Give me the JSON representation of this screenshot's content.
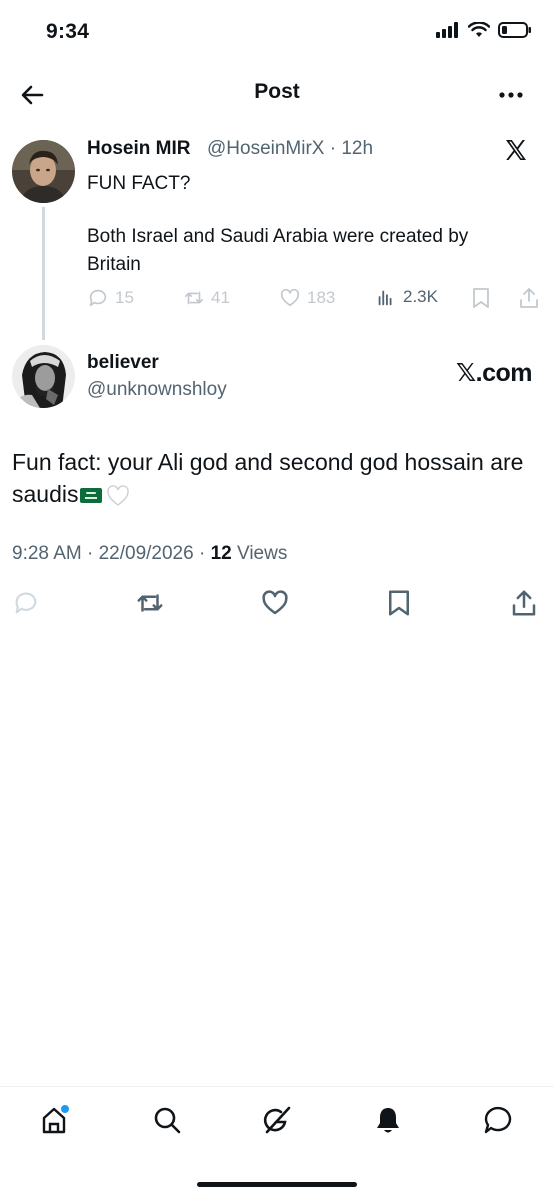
{
  "status_bar": {
    "time": "9:34"
  },
  "header": {
    "title": "Post"
  },
  "quoted_post": {
    "author_name": "Hosein MIR",
    "handle_time": "@HoseinMirX · 12h",
    "text_line1": "FUN FACT?",
    "text_line2": "Both Israel and Saudi Arabia were created by Britain",
    "stats": {
      "replies": "15",
      "reposts": "41",
      "likes": "183",
      "views": "2.3K"
    }
  },
  "post": {
    "author_name": "believer",
    "handle": "@unknownshloy",
    "watermark": "𝕏.com",
    "text": "Fun fact: your Ali god and second god hossain are saudis",
    "timestamp": "9:28 AM · 22/09/2026 · ",
    "views_count": "12",
    "views_label": " Views"
  },
  "colors": {
    "accent": "#1d9bf0",
    "text": "#0f1419",
    "muted": "#536471",
    "divider": "#eff3f4"
  },
  "icons": {
    "header": [
      "back-arrow-icon",
      "more-icon"
    ],
    "actions": [
      "reply-icon",
      "repost-icon",
      "like-icon",
      "bookmark-icon",
      "share-icon"
    ],
    "tabs": [
      "home-icon",
      "search-icon",
      "grok-icon",
      "notifications-icon",
      "messages-icon"
    ]
  }
}
